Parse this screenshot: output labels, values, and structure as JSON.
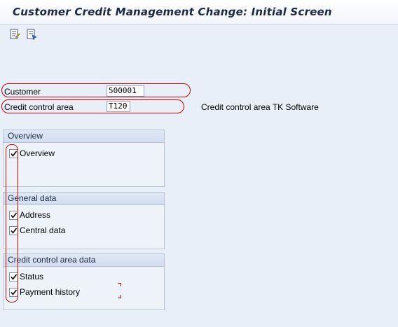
{
  "window": {
    "title": "Customer Credit Management Change: Initial Screen"
  },
  "toolbar": {
    "icons": [
      "display-change-icon",
      "create-icon"
    ]
  },
  "fields": {
    "customer": {
      "label": "Customer",
      "value": "500001"
    },
    "credit_control_area": {
      "label": "Credit control area",
      "value": "T120",
      "description": "Credit control area TK Software"
    }
  },
  "groups": {
    "overview": {
      "title": "Overview",
      "items": [
        {
          "label": "Overview",
          "checked": true
        }
      ]
    },
    "general": {
      "title": "General data",
      "items": [
        {
          "label": "Address",
          "checked": true
        },
        {
          "label": "Central data",
          "checked": true
        }
      ]
    },
    "credit_area": {
      "title": "Credit control area data",
      "items": [
        {
          "label": "Status",
          "checked": true
        },
        {
          "label": "Payment history",
          "checked": true
        }
      ]
    }
  },
  "colors": {
    "annotation": "#d00000",
    "background": "#e9eff8"
  }
}
